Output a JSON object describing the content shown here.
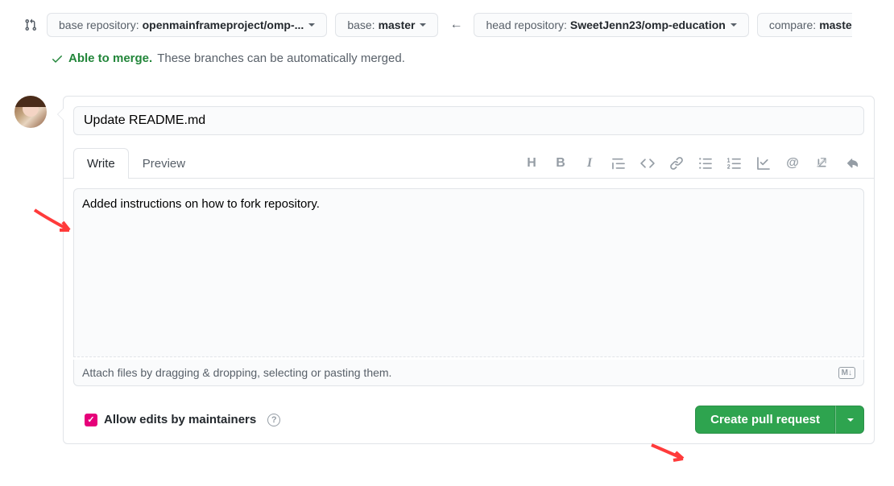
{
  "branch": {
    "baseRepoLabel": "base repository: ",
    "baseRepoValue": "openmainframeproject/omp-...",
    "baseLabel": "base: ",
    "baseValue": "master",
    "headRepoLabel": "head repository: ",
    "headRepoValue": "SweetJenn23/omp-education",
    "compareLabel": "compare: ",
    "compareValue": "maste"
  },
  "merge": {
    "able": "Able to merge.",
    "msg": "These branches can be automatically merged."
  },
  "form": {
    "title": "Update README.md",
    "writeTab": "Write",
    "previewTab": "Preview",
    "body": "Added instructions on how to fork repository.",
    "attachHint": "Attach files by dragging & dropping, selecting or pasting them.",
    "mdBadge": "M↓",
    "allowEdits": "Allow edits by maintainers",
    "createBtn": "Create pull request"
  }
}
